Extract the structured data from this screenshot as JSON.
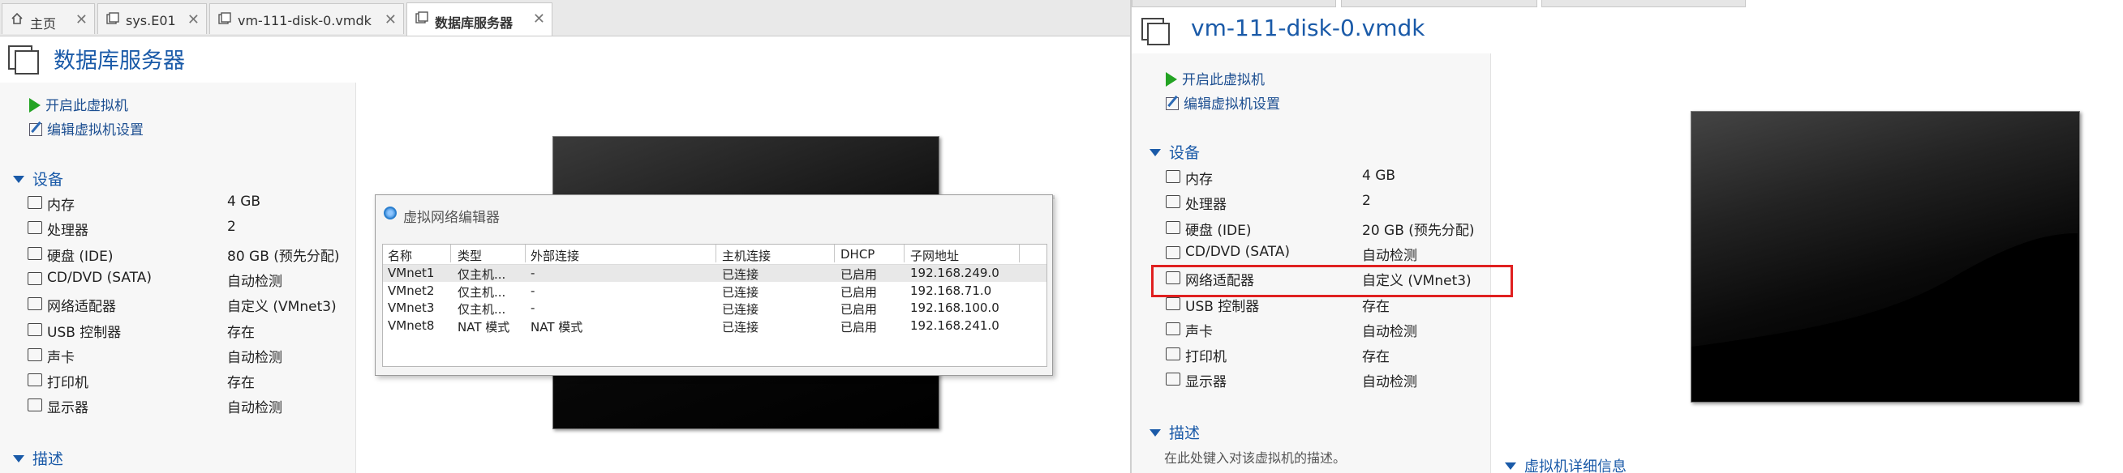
{
  "left_window": {
    "tabs": [
      {
        "label": "主页",
        "icon": "home-icon"
      },
      {
        "label": "sys.E01",
        "icon": "vm-icon"
      },
      {
        "label": "vm-111-disk-0.vmdk",
        "icon": "vm-icon"
      },
      {
        "label": "数据库服务器",
        "icon": "vm-icon"
      }
    ],
    "vm_title": "数据库服务器",
    "actions": {
      "power_on": "开启此虚拟机",
      "edit_settings": "编辑虚拟机设置"
    },
    "devices_section": "设备",
    "devices": [
      {
        "name": "内存",
        "value": "4 GB",
        "icon": "memory-icon"
      },
      {
        "name": "处理器",
        "value": "2",
        "icon": "cpu-icon"
      },
      {
        "name": "硬盘 (IDE)",
        "value": "80 GB (预先分配)",
        "icon": "harddisk-icon"
      },
      {
        "name": "CD/DVD (SATA)",
        "value": "自动检测",
        "icon": "cdrom-icon"
      },
      {
        "name": "网络适配器",
        "value": "自定义 (VMnet3)",
        "icon": "network-adapter-icon"
      },
      {
        "name": "USB 控制器",
        "value": "存在",
        "icon": "usb-icon"
      },
      {
        "name": "声卡",
        "value": "自动检测",
        "icon": "sound-icon"
      },
      {
        "name": "打印机",
        "value": "存在",
        "icon": "printer-icon"
      },
      {
        "name": "显示器",
        "value": "自动检测",
        "icon": "display-icon"
      }
    ],
    "description_section": "描述"
  },
  "network_editor": {
    "title": "虚拟网络编辑器",
    "columns": [
      "名称",
      "类型",
      "外部连接",
      "主机连接",
      "DHCP",
      "子网地址"
    ],
    "rows": [
      [
        "VMnet1",
        "仅主机...",
        "-",
        "已连接",
        "已启用",
        "192.168.249.0"
      ],
      [
        "VMnet2",
        "仅主机...",
        "-",
        "已连接",
        "已启用",
        "192.168.71.0"
      ],
      [
        "VMnet3",
        "仅主机...",
        "-",
        "已连接",
        "已启用",
        "192.168.100.0"
      ],
      [
        "VMnet8",
        "NAT 模式",
        "NAT 模式",
        "已连接",
        "已启用",
        "192.168.241.0"
      ]
    ]
  },
  "right_window": {
    "vm_title": "vm-111-disk-0.vmdk",
    "actions": {
      "power_on": "开启此虚拟机",
      "edit_settings": "编辑虚拟机设置"
    },
    "devices_section": "设备",
    "devices": [
      {
        "name": "内存",
        "value": "4 GB",
        "icon": "memory-icon"
      },
      {
        "name": "处理器",
        "value": "2",
        "icon": "cpu-icon"
      },
      {
        "name": "硬盘 (IDE)",
        "value": "20 GB (预先分配)",
        "icon": "harddisk-icon"
      },
      {
        "name": "CD/DVD (SATA)",
        "value": "自动检测",
        "icon": "cdrom-icon"
      },
      {
        "name": "网络适配器",
        "value": "自定义 (VMnet3)",
        "icon": "network-adapter-icon"
      },
      {
        "name": "USB 控制器",
        "value": "存在",
        "icon": "usb-icon"
      },
      {
        "name": "声卡",
        "value": "自动检测",
        "icon": "sound-icon"
      },
      {
        "name": "打印机",
        "value": "存在",
        "icon": "printer-icon"
      },
      {
        "name": "显示器",
        "value": "自动检测",
        "icon": "display-icon"
      }
    ],
    "description_section": "描述",
    "description_placeholder": "在此处键入对该虚拟机的描述。",
    "details_section": "虚拟机详细信息",
    "highlight_color": "#e02020"
  },
  "colors": {
    "accent": "#1a5aa8",
    "play": "#23a323"
  }
}
